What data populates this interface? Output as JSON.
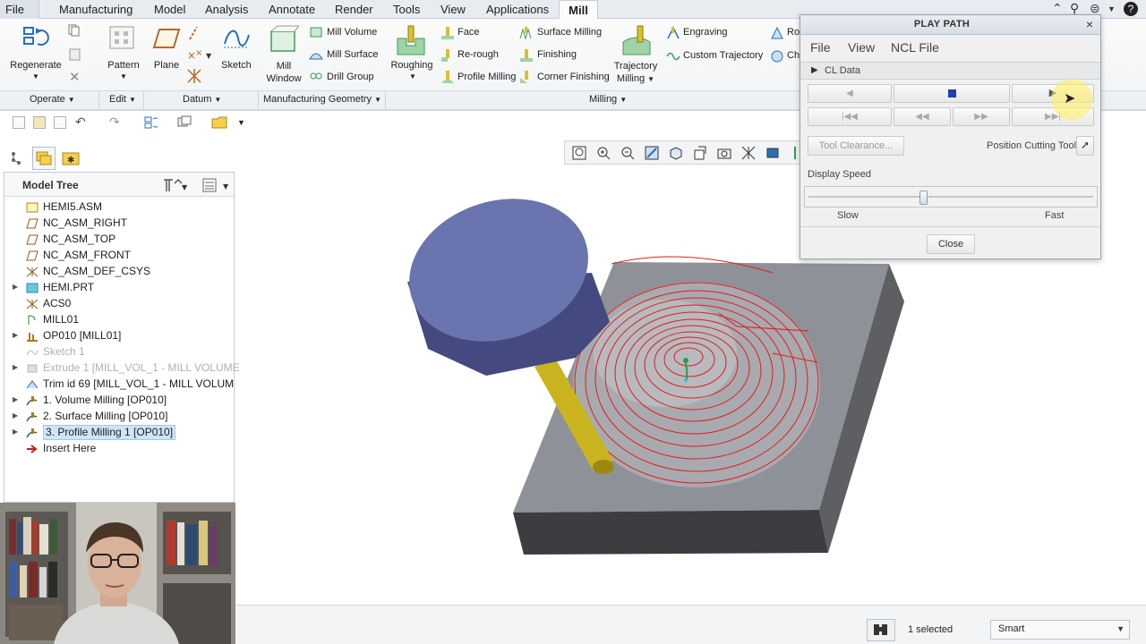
{
  "tabs": [
    "File",
    "Manufacturing",
    "Model",
    "Analysis",
    "Annotate",
    "Render",
    "Tools",
    "View",
    "Applications",
    "Mill"
  ],
  "ribbon": {
    "regenerate": "Regenerate",
    "pattern": "Pattern",
    "plane": "Plane",
    "sketch": "Sketch",
    "mill_window": [
      "Mill",
      "Window"
    ],
    "mill_volume": "Mill Volume",
    "mill_surface": "Mill Surface",
    "drill_group": "Drill Group",
    "roughing": "Roughing",
    "face": "Face",
    "re_rough": "Re-rough",
    "profile_milling": "Profile Milling",
    "surface_milling": "Surface Milling",
    "finishing": "Finishing",
    "corner_finishing": "Corner Finishing",
    "trajectory_milling": [
      "Trajectory",
      "Milling"
    ],
    "engraving": "Engraving",
    "custom_trajectory": "Custom Trajectory",
    "ro": "Ro",
    "ch": "Ch"
  },
  "groups": {
    "operate": "Operate",
    "edit": "Edit",
    "datum": "Datum",
    "mfg_geometry": "Manufacturing Geometry",
    "milling": "Milling"
  },
  "model_tree": {
    "title": "Model Tree",
    "items": [
      {
        "label": "HEMI5.ASM",
        "icon": "assembly-icon",
        "expandable": false,
        "state": "normal"
      },
      {
        "label": "NC_ASM_RIGHT",
        "icon": "datum-plane-icon",
        "expandable": false,
        "state": "normal"
      },
      {
        "label": "NC_ASM_TOP",
        "icon": "datum-plane-icon",
        "expandable": false,
        "state": "normal"
      },
      {
        "label": "NC_ASM_FRONT",
        "icon": "datum-plane-icon",
        "expandable": false,
        "state": "normal"
      },
      {
        "label": "NC_ASM_DEF_CSYS",
        "icon": "coordinate-system-icon",
        "expandable": false,
        "state": "normal"
      },
      {
        "label": "HEMI.PRT",
        "icon": "part-icon",
        "expandable": true,
        "state": "normal"
      },
      {
        "label": "ACS0",
        "icon": "coordinate-system-icon",
        "expandable": false,
        "state": "normal"
      },
      {
        "label": "MILL01",
        "icon": "workcell-icon",
        "expandable": false,
        "state": "normal"
      },
      {
        "label": "OP010 [MILL01]",
        "icon": "operation-icon",
        "expandable": true,
        "state": "normal"
      },
      {
        "label": "Sketch 1",
        "icon": "sketch-icon",
        "expandable": false,
        "state": "gray"
      },
      {
        "label": "Extrude 1 [MILL_VOL_1 - MILL VOLUME",
        "icon": "extrude-icon",
        "expandable": true,
        "state": "gray"
      },
      {
        "label": "Trim id 69 [MILL_VOL_1 - MILL VOLUM",
        "icon": "trim-icon",
        "expandable": false,
        "state": "normal"
      },
      {
        "label": "1. Volume Milling [OP010]",
        "icon": "milling-step-icon",
        "expandable": true,
        "state": "normal"
      },
      {
        "label": "2. Surface Milling [OP010]",
        "icon": "milling-step-icon",
        "expandable": true,
        "state": "normal"
      },
      {
        "label": "3. Profile Milling 1 [OP010]",
        "icon": "milling-step-icon",
        "expandable": true,
        "state": "selected"
      },
      {
        "label": "Insert Here",
        "icon": "insert-arrow-icon",
        "expandable": false,
        "state": "normal"
      }
    ]
  },
  "dialog": {
    "title": "PLAY PATH",
    "menu": [
      "File",
      "View",
      "NCL File"
    ],
    "cl_data": "CL Data",
    "tool_clearance": "Tool Clearance...",
    "position_cutting_tool": "Position Cutting Tool",
    "display_speed": "Display Speed",
    "slow": "Slow",
    "fast": "Fast",
    "close": "Close",
    "speed_level": 0.4
  },
  "status": {
    "selected": "1 selected",
    "filter": "Smart"
  },
  "colors": {
    "tool_holder": "#6a74ae",
    "tool_shank": "#c9b41f",
    "toolpath": "#e01c1c",
    "stock": "#8d9096",
    "selection_highlight": "#cfe5fa"
  }
}
